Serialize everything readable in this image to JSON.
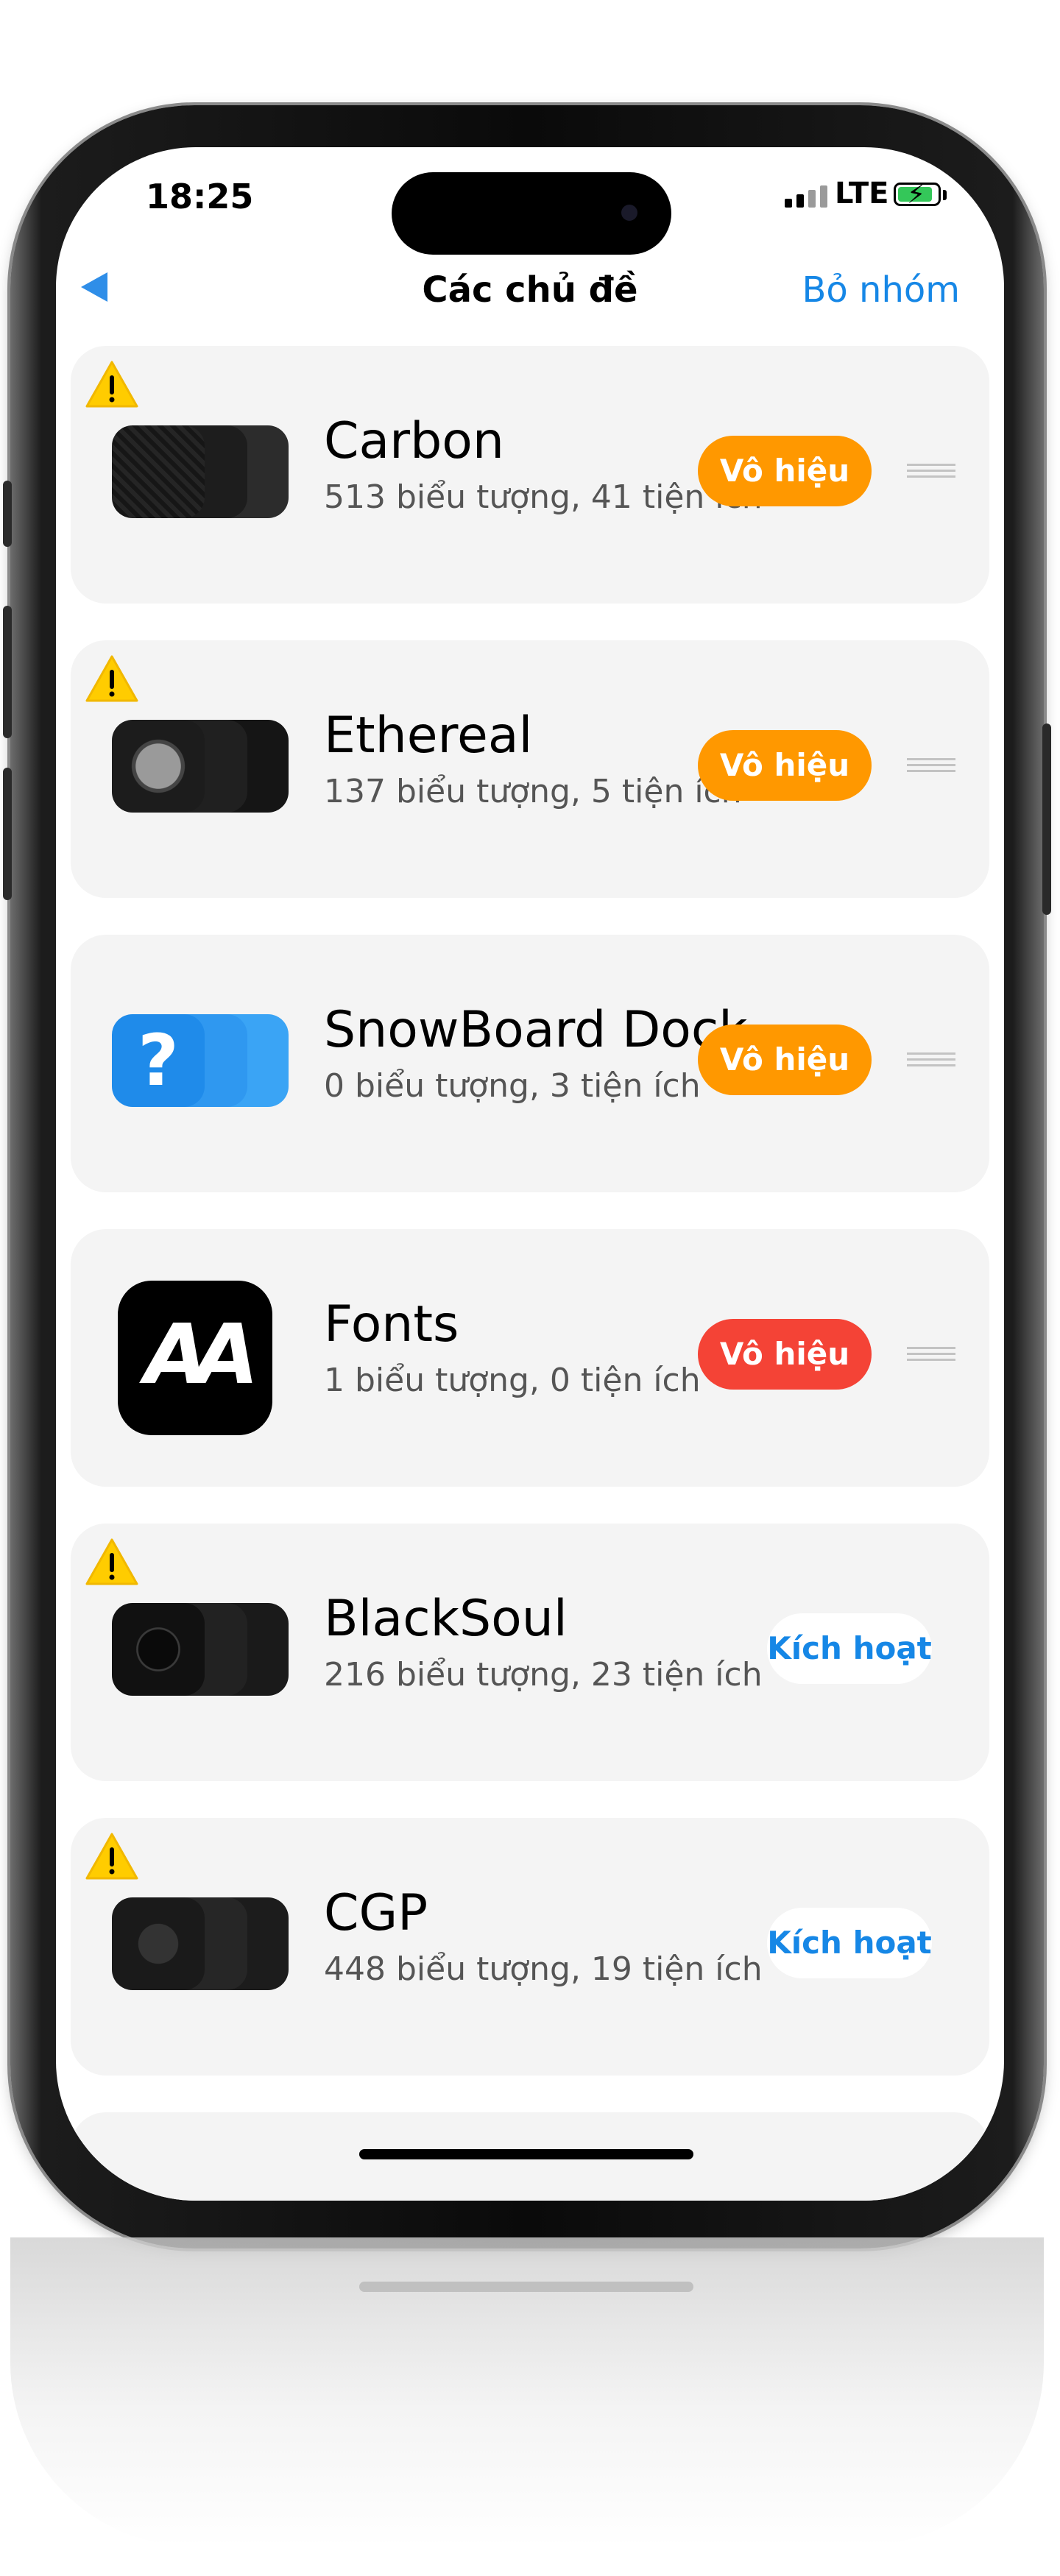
{
  "status_bar": {
    "time": "18:25",
    "network": "LTE"
  },
  "nav": {
    "title": "Các chủ đề",
    "action": "Bỏ nhóm"
  },
  "themes": [
    {
      "name": "Carbon",
      "subtitle": "513 biểu tượng, 41 tiện ích",
      "button": "Vô hiệu",
      "button_style": "orange",
      "warning": true
    },
    {
      "name": "Ethereal",
      "subtitle": "137 biểu tượng, 5 tiện ích",
      "button": "Vô hiệu",
      "button_style": "orange",
      "warning": true
    },
    {
      "name": "SnowBoard Dock",
      "subtitle": "0 biểu tượng, 3 tiện ích",
      "button": "Vô hiệu",
      "button_style": "orange",
      "warning": false
    },
    {
      "name": "Fonts",
      "subtitle": "1 biểu tượng, 0 tiện ích",
      "button": "Vô hiệu",
      "button_style": "red",
      "warning": false
    },
    {
      "name": "BlackSoul",
      "subtitle": "216 biểu tượng, 23 tiện ích",
      "button": "Kích hoạt",
      "button_style": "link",
      "warning": true
    },
    {
      "name": "CGP",
      "subtitle": "448 biểu tượng, 19 tiện ích",
      "button": "Kích hoạt",
      "button_style": "link",
      "warning": true
    }
  ],
  "icons": {
    "back": "chevron-left-icon",
    "warning": "warning-triangle-icon",
    "reorder": "drag-handle-icon",
    "fonts_glyph": "AA"
  },
  "colors": {
    "accent": "#1687e6",
    "disable_button": "#ff9800",
    "disable_button_alt": "#f44336",
    "card_background": "#f4f4f4",
    "warning": "#ffcc00"
  }
}
